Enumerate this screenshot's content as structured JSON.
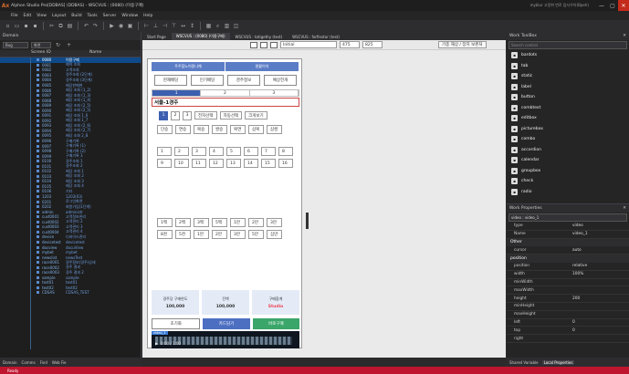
{
  "window": {
    "title": "Alphon Studio Pro[DDBAS] (DDBAS) - WSCVUS : (0080) (이용구매)",
    "user": "myblur 고정취 번로 탐사우아(Bpeh)",
    "min": "—",
    "max": "▢",
    "close": "✕"
  },
  "app_logo": "Ax",
  "menu": [
    "File",
    "Edit",
    "View",
    "Layout",
    "Build",
    "Tools",
    "Server",
    "Window",
    "Help"
  ],
  "left_panel": {
    "title": "Domain",
    "filter_label": "Bug",
    "filter2": "화면",
    "col_screen": "Screen ID",
    "col_name": "Name",
    "rows": [
      {
        "id": "0080",
        "name": "이용구매",
        "sel": true
      },
      {
        "id": "0081",
        "name": "예약 조회"
      },
      {
        "id": "0082",
        "name": "고객조회"
      },
      {
        "id": "0083",
        "name": "경주조회 (2단계)"
      },
      {
        "id": "0084",
        "name": "경주조회 (3단계)"
      },
      {
        "id": "0085",
        "name": "배당판매현"
      },
      {
        "id": "0086",
        "name": "배당 조회 (1_2)"
      },
      {
        "id": "0087",
        "name": "배당 조회 (1_3)"
      },
      {
        "id": "0088",
        "name": "배당 조회 (1_4)"
      },
      {
        "id": "0089",
        "name": "배당 조회 (2_5)"
      },
      {
        "id": "0090",
        "name": "배당 조회 (2_5)"
      },
      {
        "id": "0091",
        "name": "배당 조회 1_6"
      },
      {
        "id": "0092",
        "name": "배당 조회 1_7"
      },
      {
        "id": "0093",
        "name": "배당 조회 (2_6)"
      },
      {
        "id": "0094",
        "name": "배당 조회 (2_7)"
      },
      {
        "id": "0095",
        "name": "배당 조회 2_8"
      },
      {
        "id": "0096",
        "name": "구매기록"
      },
      {
        "id": "0097",
        "name": "구매기록 (1)"
      },
      {
        "id": "0098",
        "name": "구매기록 (2)"
      },
      {
        "id": "0099",
        "name": "구매기록 3"
      },
      {
        "id": "0100",
        "name": "경주조회 1"
      },
      {
        "id": "0101",
        "name": "경주조회 2"
      },
      {
        "id": "0102",
        "name": "배당 조회 1"
      },
      {
        "id": "0103",
        "name": "배당 조회 2"
      },
      {
        "id": "0104",
        "name": "배당 조회 3"
      },
      {
        "id": "0105",
        "name": "배당 조회 4"
      },
      {
        "id": "0106",
        "name": "기타"
      },
      {
        "id": "1203",
        "name": "1203(03)"
      },
      {
        "id": "0201",
        "name": "로그인화면"
      },
      {
        "id": "0202",
        "name": "회원가입(1단계)"
      },
      {
        "id": "admin",
        "name": "administr"
      },
      {
        "id": "cust0001",
        "name": "고객정보관리"
      },
      {
        "id": "cust0002",
        "name": "고객관리 2"
      },
      {
        "id": "cust0003",
        "name": "고객관리 3"
      },
      {
        "id": "cust0004",
        "name": "고객관리 4"
      },
      {
        "id": "device",
        "name": "디바이스관리"
      },
      {
        "id": "devicetest",
        "name": "devicetest"
      },
      {
        "id": "docview",
        "name": "docuView"
      },
      {
        "id": "mybet",
        "name": "mybet"
      },
      {
        "id": "newslist",
        "name": "newsTest"
      },
      {
        "id": "race0001",
        "name": "경주정보(경주)상세"
      },
      {
        "id": "race0002",
        "name": "경주 결과"
      },
      {
        "id": "race0003",
        "name": "경주 결과 2"
      },
      {
        "id": "sample",
        "name": "sample"
      },
      {
        "id": "test01",
        "name": "test01"
      },
      {
        "id": "test02",
        "name": "test02"
      },
      {
        "id": "CDSAS",
        "name": "CDSAS_TEST"
      }
    ],
    "bottom_tabs": [
      "Domain",
      "Comms",
      "Find",
      "Web Fie"
    ]
  },
  "doc_tabs": [
    "Start Page",
    "WSCVUS : (0080) (이용구매)",
    "WSCVUS : totigethy (test)",
    "WSCVUS : forfinstor (test)"
  ],
  "design_bar": {
    "device": "Initial",
    "width": "475",
    "height": "825",
    "action": "기종 해상 / 장치 보존처"
  },
  "phone": {
    "top_tabs": [
      "주주참노이용나해",
      "원활이석"
    ],
    "btns": [
      "현재배당",
      "인기배당",
      "경주정보",
      "예상전개"
    ],
    "steps": [
      "1",
      "2",
      "3"
    ],
    "race": "서울-1경주",
    "pages": [
      "1",
      "2",
      "3"
    ],
    "page_tags": [
      "전자선택",
      "자동선택",
      "크게보기"
    ],
    "bet_types": [
      "단승",
      "연승",
      "복승",
      "쌍승",
      "복연",
      "삼복",
      "삼쌍"
    ],
    "numbers": [
      "1",
      "2",
      "3",
      "4",
      "5",
      "6",
      "7",
      "8",
      "9",
      "10",
      "11",
      "12",
      "13",
      "14",
      "15",
      "16"
    ],
    "amounts": [
      "1백",
      "2백",
      "3백",
      "5백",
      "1만",
      "2만",
      "3만",
      "8천",
      "5천",
      "1만",
      "2만",
      "3만",
      "5만",
      "십만"
    ],
    "info": [
      {
        "label": "경주당 구매한도",
        "value": "100,000"
      },
      {
        "label": "잔액",
        "value": "100,000"
      },
      {
        "label": "구매합계",
        "value": "Studio",
        "red": true
      }
    ],
    "actions": [
      "초기화",
      "카드담기",
      "바로구매"
    ],
    "video_label": "video_1",
    "video_time": "0:00 / 1:00"
  },
  "right_panel": {
    "title": "Work ToolBox",
    "search": "Search control",
    "widgets": [
      "bardots",
      "tab",
      "static",
      "label",
      "button",
      "combtext",
      "editbox",
      "picturebox",
      "combo",
      "accordion",
      "calendar",
      "groupbox",
      "check",
      "radio"
    ],
    "prop_title": "Work Properties",
    "prop_sel": "video : video_1",
    "props": [
      {
        "k": "type",
        "v": "video"
      },
      {
        "k": "Name",
        "v": "video_1"
      },
      {
        "cat": "Other"
      },
      {
        "k": "cursor",
        "v": "auto"
      },
      {
        "cat": "position"
      },
      {
        "k": "position",
        "v": "relative"
      },
      {
        "k": "width",
        "v": "100%"
      },
      {
        "k": "minWidth",
        "v": ""
      },
      {
        "k": "maxWidth",
        "v": ""
      },
      {
        "k": "height",
        "v": "200"
      },
      {
        "k": "minHeight",
        "v": ""
      },
      {
        "k": "maxHeight",
        "v": ""
      },
      {
        "k": "left",
        "v": "0"
      },
      {
        "k": "top",
        "v": "0"
      },
      {
        "k": "right",
        "v": ""
      }
    ],
    "bottom_tabs": [
      "Shared Variable",
      "Local Properties"
    ]
  },
  "status": "Ready"
}
